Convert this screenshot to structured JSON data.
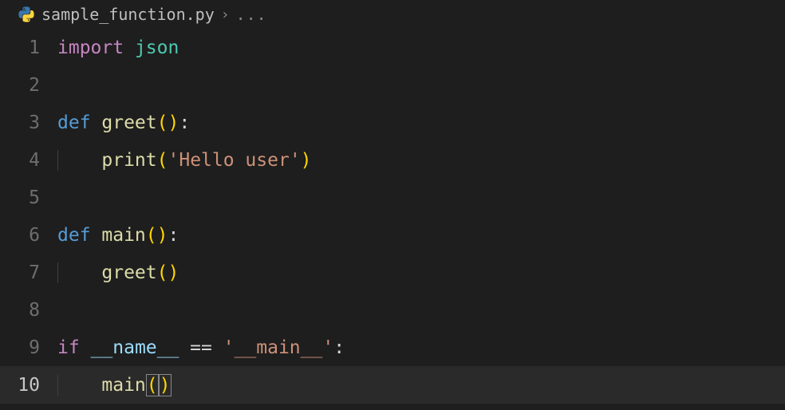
{
  "breadcrumb": {
    "filename": "sample_function.py",
    "rest": "..."
  },
  "lines": {
    "l1": {
      "num": "1",
      "kw_import": "import",
      "mod_json": " json"
    },
    "l2": {
      "num": "2"
    },
    "l3": {
      "num": "3",
      "kw_def": "def",
      "fn_greet": " greet",
      "paren_l": "(",
      "paren_r": ")",
      "colon": ":"
    },
    "l4": {
      "num": "4",
      "indent": "    ",
      "fn_print": "print",
      "paren_l": "(",
      "str": "'Hello user'",
      "paren_r": ")"
    },
    "l5": {
      "num": "5"
    },
    "l6": {
      "num": "6",
      "kw_def": "def",
      "fn_main": " main",
      "paren_l": "(",
      "paren_r": ")",
      "colon": ":"
    },
    "l7": {
      "num": "7",
      "indent": "    ",
      "fn_greet": "greet",
      "paren1": "(",
      "paren2": ")"
    },
    "l8": {
      "num": "8"
    },
    "l9": {
      "num": "9",
      "kw_if": "if",
      "var_name": " __name__",
      "op_eq": " == ",
      "str_main": "'__main__'",
      "colon": ":"
    },
    "l10": {
      "num": "10",
      "indent": "    ",
      "fn_main": "main",
      "paren1": "(",
      "paren2": ")"
    }
  }
}
